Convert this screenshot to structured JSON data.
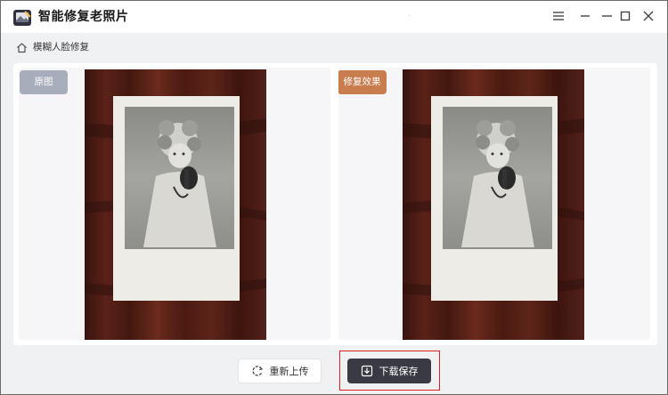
{
  "app": {
    "title": "智能修复老照片",
    "logo_icon": "photo-repair-logo-icon"
  },
  "titlebar": {
    "menu_icon": "hamburger-menu-icon",
    "minimize_icon": "minimize-icon",
    "maximize_icon": "maximize-icon",
    "close_icon": "close-icon"
  },
  "breadcrumb": {
    "icon": "home-icon",
    "label": "模糊人脸修复"
  },
  "compare": {
    "original_label": "原图",
    "repaired_label": "修复效果"
  },
  "actions": {
    "reupload_label": "重新上传",
    "reupload_icon": "refresh-icon",
    "download_label": "下载保存",
    "download_icon": "download-icon"
  },
  "colors": {
    "original_tag": "#a8adbb",
    "repaired_tag": "#c97d4e",
    "download_button": "#3a3a44",
    "highlight_border": "#e02020",
    "background": "#f0f1f3"
  }
}
